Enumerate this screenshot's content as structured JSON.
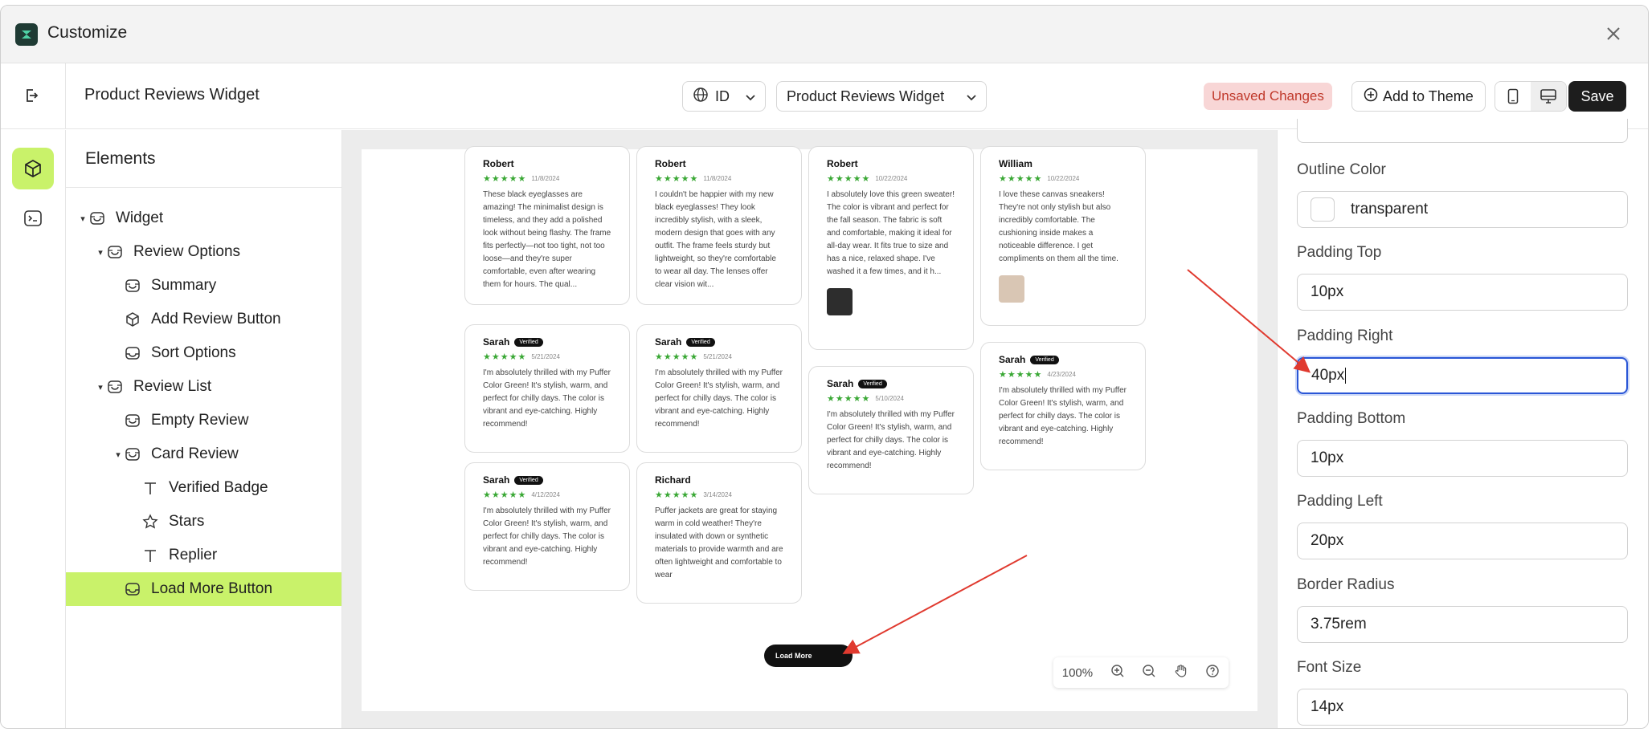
{
  "app": {
    "title": "Customize"
  },
  "toolbar": {
    "page_title": "Product Reviews Widget",
    "language_value": "ID",
    "widget_select": "Product Reviews Widget",
    "unsaved_label": "Unsaved Changes",
    "add_to_theme_label": "Add to Theme",
    "save_label": "Save"
  },
  "elements": {
    "heading": "Elements",
    "tree": [
      {
        "label": "Widget",
        "icon": "widget-icon"
      },
      {
        "label": "Review Options",
        "icon": "widget-icon"
      },
      {
        "label": "Summary",
        "icon": "widget-icon"
      },
      {
        "label": "Add Review Button",
        "icon": "cube-icon"
      },
      {
        "label": "Sort Options",
        "icon": "tray-icon"
      },
      {
        "label": "Review List",
        "icon": "widget-icon"
      },
      {
        "label": "Empty Review",
        "icon": "widget-icon"
      },
      {
        "label": "Card Review",
        "icon": "widget-icon"
      },
      {
        "label": "Verified Badge",
        "icon": "text-icon"
      },
      {
        "label": "Stars",
        "icon": "star-icon"
      },
      {
        "label": "Replier",
        "icon": "text-icon"
      },
      {
        "label": "Load More Button",
        "icon": "tray-icon"
      }
    ],
    "selected": "Load More Button"
  },
  "preview": {
    "reviews": [
      {
        "name": "Robert",
        "verified": "",
        "date": "11/8/2024",
        "text": "These black eyeglasses are amazing! The minimalist design is timeless, and they add a polished look without being flashy. The frame fits perfectly—not too tight, not too loose—and they're super comfortable, even after wearing them for hours. The qual..."
      },
      {
        "name": "Robert",
        "verified": "",
        "date": "11/8/2024",
        "text": "I couldn't be happier with my new black eyeglasses! They look incredibly stylish, with a sleek, modern design that goes with any outfit. The frame feels sturdy but lightweight, so they're comfortable to wear all day. The lenses offer clear vision wit..."
      },
      {
        "name": "Robert",
        "verified": "",
        "date": "10/22/2024",
        "text": "I absolutely love this green sweater! The color is vibrant and perfect for the fall season. The fabric is soft and comfortable, making it ideal for all-day wear. It fits true to size and has a nice, relaxed shape. I've washed it a few times, and it h..."
      },
      {
        "name": "William",
        "verified": "",
        "date": "10/22/2024",
        "text": "I love these canvas sneakers! They're not only stylish but also incredibly comfortable. The cushioning inside makes a noticeable difference. I get compliments on them all the time."
      },
      {
        "name": "Sarah",
        "verified": "Verified",
        "date": "5/21/2024",
        "text": "I'm absolutely thrilled with my Puffer Color Green! It's stylish, warm, and perfect for chilly days. The color is vibrant and eye-catching. Highly recommend!"
      },
      {
        "name": "Sarah",
        "verified": "Verified",
        "date": "5/21/2024",
        "text": "I'm absolutely thrilled with my Puffer Color Green! It's stylish, warm, and perfect for chilly days. The color is vibrant and eye-catching. Highly recommend!"
      },
      {
        "name": "Sarah",
        "verified": "Verified",
        "date": "5/10/2024",
        "text": "I'm absolutely thrilled with my Puffer Color Green! It's stylish, warm, and perfect for chilly days. The color is vibrant and eye-catching. Highly recommend!"
      },
      {
        "name": "Sarah",
        "verified": "Verified",
        "date": "4/23/2024",
        "text": "I'm absolutely thrilled with my Puffer Color Green! It's stylish, warm, and perfect for chilly days. The color is vibrant and eye-catching. Highly recommend!"
      },
      {
        "name": "Sarah",
        "verified": "Verified",
        "date": "4/12/2024",
        "text": "I'm absolutely thrilled with my Puffer Color Green! It's stylish, warm, and perfect for chilly days. The color is vibrant and eye-catching. Highly recommend!"
      },
      {
        "name": "Richard",
        "verified": "",
        "date": "3/14/2024",
        "text": "Puffer jackets are great for staying warm in cold weather! They're insulated with down or synthetic materials to provide warmth and are often lightweight and comfortable to wear"
      }
    ],
    "stars": "★★★★★",
    "load_more_label": "Load More",
    "zoom_level": "100%"
  },
  "properties": {
    "outline_color_label": "Outline Color",
    "outline_color_value": "transparent",
    "padding_top_label": "Padding Top",
    "padding_top_value": "10px",
    "padding_right_label": "Padding Right",
    "padding_right_value": "40px",
    "padding_bottom_label": "Padding Bottom",
    "padding_bottom_value": "10px",
    "padding_left_label": "Padding Left",
    "padding_left_value": "20px",
    "border_radius_label": "Border Radius",
    "border_radius_value": "3.75rem",
    "font_size_label": "Font Size",
    "font_size_value": "14px"
  },
  "colors": {
    "accent": "#c9f26a",
    "star": "#3aa835",
    "focus": "#2a56d6",
    "annotation": "#e03a2f",
    "unsaved_bg": "#f8d6d6"
  }
}
